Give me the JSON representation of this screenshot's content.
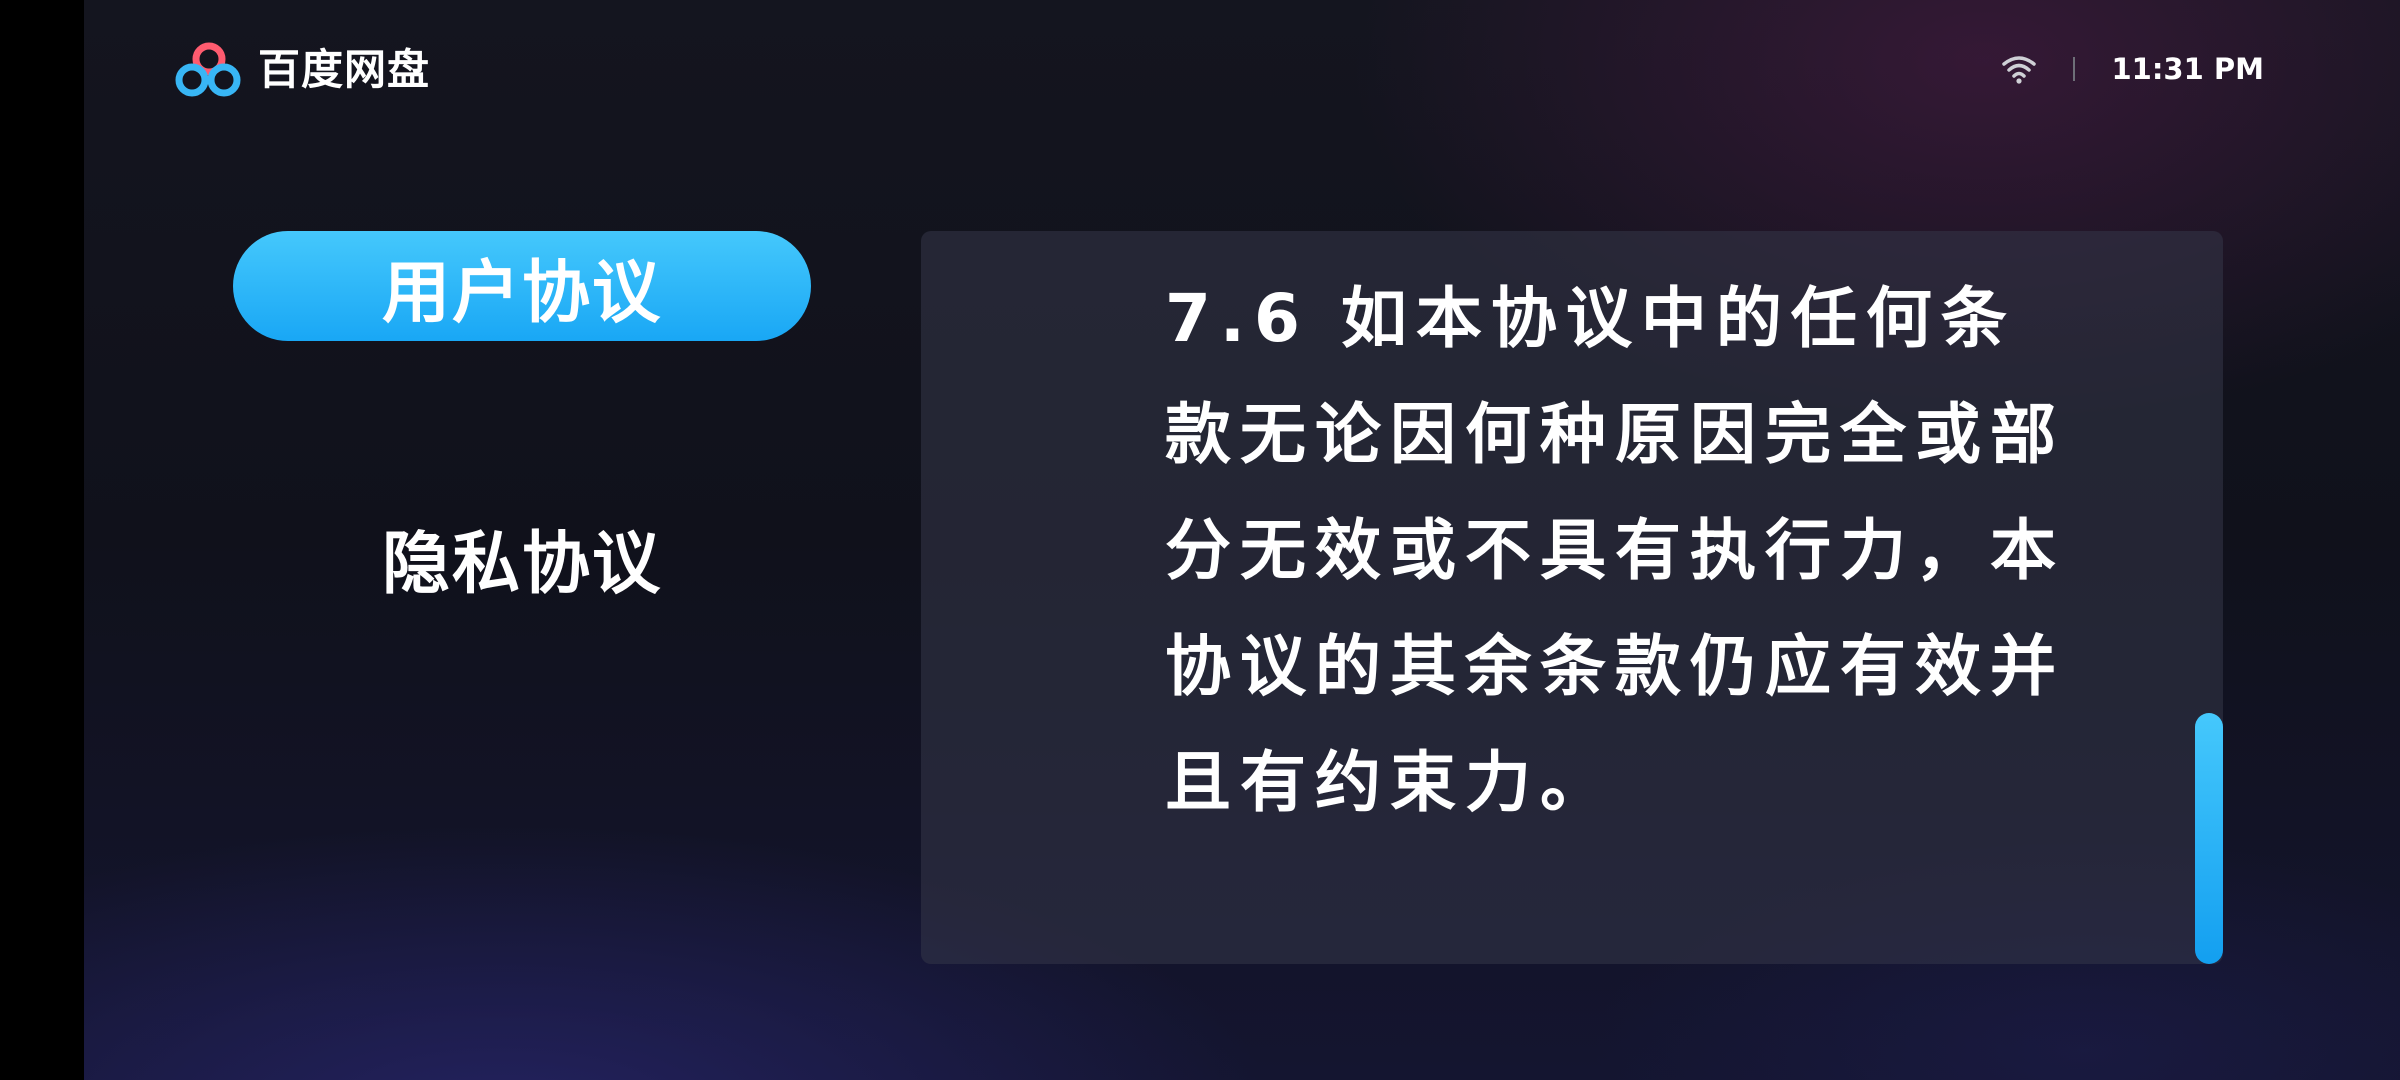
{
  "app": {
    "name": "百度网盘",
    "logo_icon": "baidu-netdisk-logo-icon"
  },
  "status_bar": {
    "wifi_icon": "wifi-icon",
    "time": "11:31 PM"
  },
  "menu": {
    "items": [
      {
        "label": "用户协议",
        "selected": true
      },
      {
        "label": "隐私协议",
        "selected": false
      }
    ]
  },
  "content": {
    "text": "7.6 如本协议中的任何条款无论因何种原因完全或部分无效或不具有执行力，本协议的其余条款仍应有效并且有约束力。",
    "scroll_position": 1.0
  },
  "colors": {
    "accent": "#1fb0f7",
    "background": "#12131d",
    "panel": "#2a2c3a",
    "text": "#ffffff"
  }
}
